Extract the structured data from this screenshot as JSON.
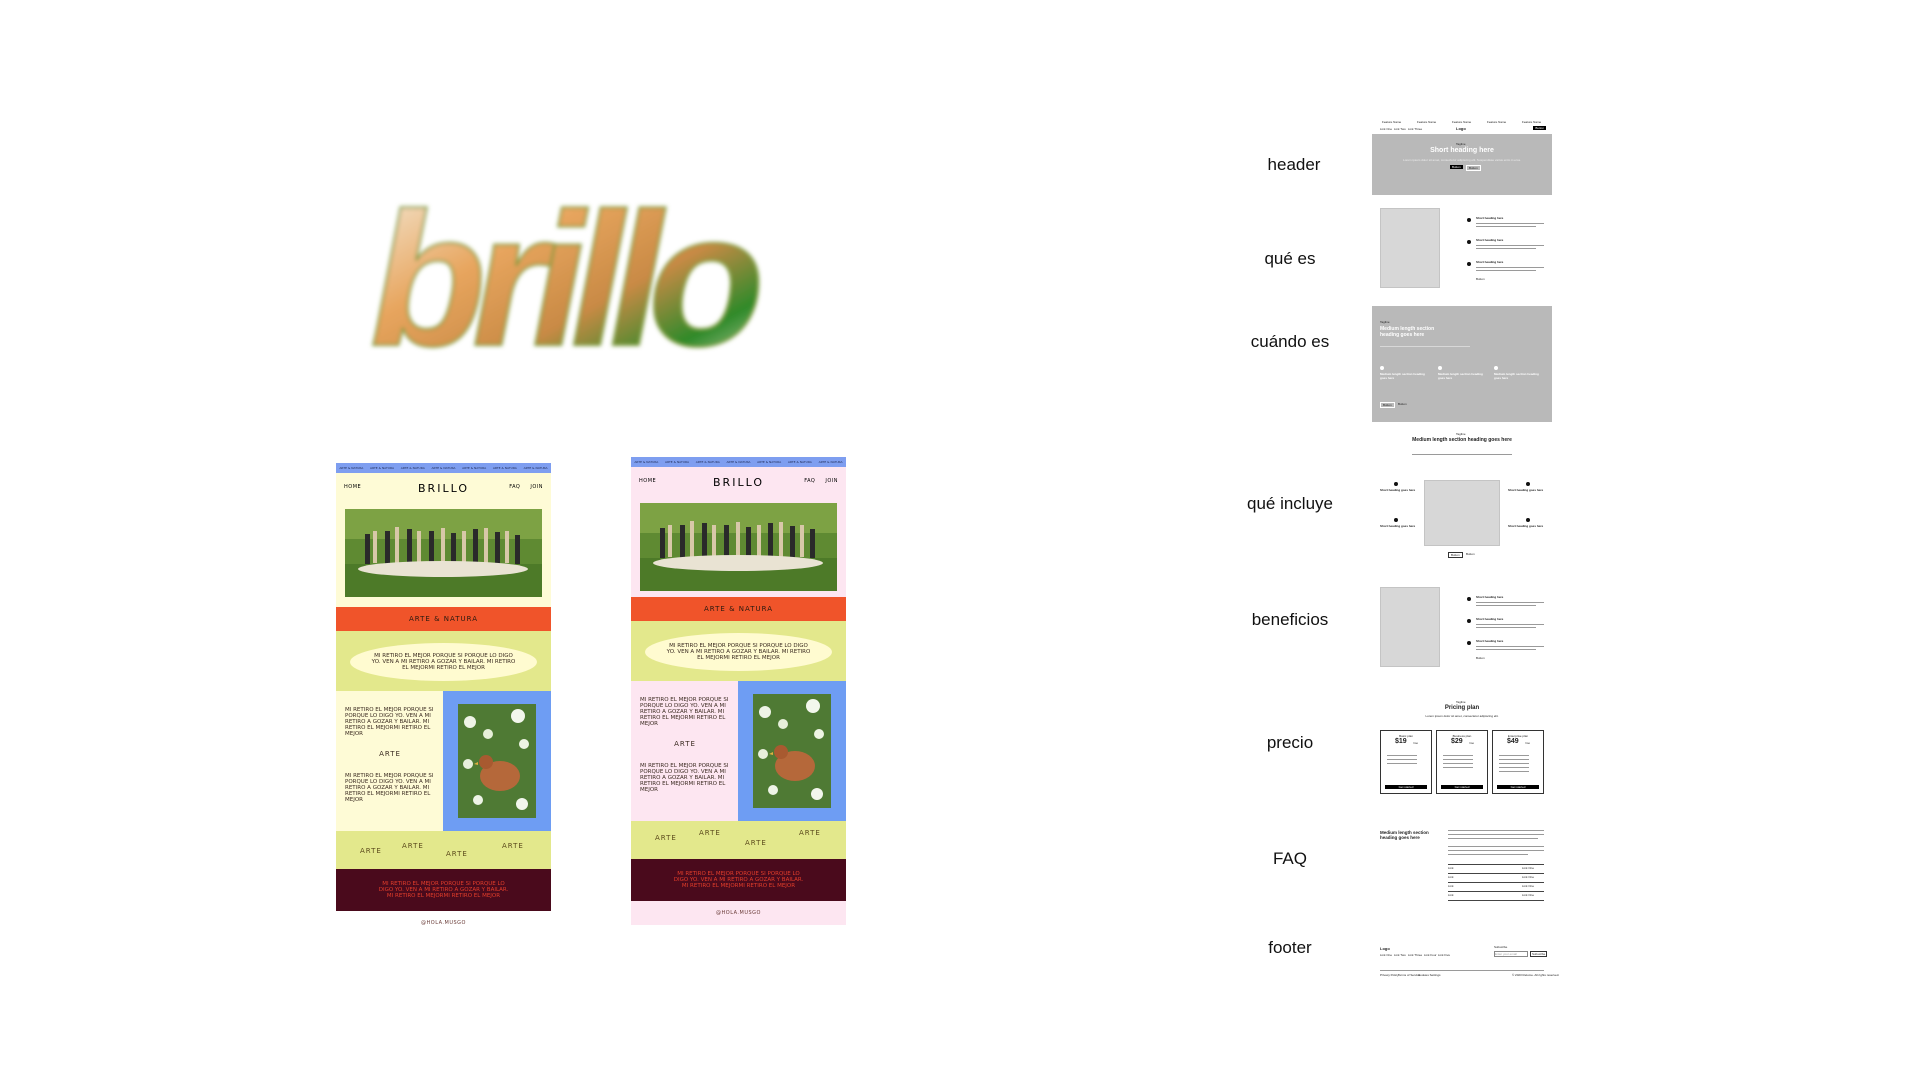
{
  "logo": {
    "text": "brillo"
  },
  "mockups": [
    {
      "id": "yellow",
      "ticker": [
        "ARTE & NATURA",
        "ARTE & NATURA",
        "ARTE & NATURA",
        "ARTE & NATURA",
        "ARTE & NATURA",
        "ARTE & NATURA",
        "ARTE & NATURA"
      ],
      "nav_home": "HOME",
      "brand": "BRILLO",
      "nav_faq": "FAQ",
      "nav_join": "JOIN",
      "band": "ARTE & NATURA",
      "ellipse_text": "MI RETIRO EL MEJOR PORQUE SI PORQUE LO DIGO YO. VEN A MI RETIRO A GOZAR Y BAILAR. MI RETIRO EL MEJORMI RETIRO EL MEJOR",
      "split_text_1": "MI RETIRO EL MEJOR PORQUE SI PORQUE LO DIGO YO. VEN A MI RETIRO A GOZAR Y BAILAR. MI RETIRO EL MEJORMI RETIRO EL MEJOR",
      "split_mid": "ARTE",
      "split_text_2": "MI RETIRO EL MEJOR PORQUE SI PORQUE LO DIGO YO. VEN A MI RETIRO A GOZAR Y BAILAR. MI RETIRO EL MEJORMI RETIRO EL MEJOR",
      "arte": [
        "ARTE",
        "ARTE",
        "ARTE",
        "ARTE"
      ],
      "quote": "MI RETIRO EL MEJOR PORQUE SI PORQUE LO DIGO YO. VEN A MI RETIRO A GOZAR Y BAILAR. MI RETIRO EL MEJORMI RETIRO EL MEJOR",
      "footer": "@HOLA.MUSGO"
    },
    {
      "id": "pink",
      "ticker": [
        "ARTE & NATURA",
        "ARTE & NATURA",
        "ARTE & NATURA",
        "ARTE & NATURA",
        "ARTE & NATURA",
        "ARTE & NATURA",
        "ARTE & NATURA"
      ],
      "nav_home": "HOME",
      "brand": "BRILLO",
      "nav_faq": "FAQ",
      "nav_join": "JOIN",
      "band": "ARTE & NATURA",
      "ellipse_text": "MI RETIRO EL MEJOR PORQUE SI PORQUE LO DIGO YO. VEN A MI RETIRO A GOZAR Y BAILAR. MI RETIRO EL MEJORMI RETIRO EL MEJOR",
      "split_text_1": "MI RETIRO EL MEJOR PORQUE SI PORQUE LO DIGO YO. VEN A MI RETIRO A GOZAR Y BAILAR. MI RETIRO EL MEJORMI RETIRO EL MEJOR",
      "split_mid": "ARTE",
      "split_text_2": "MI RETIRO EL MEJOR PORQUE SI PORQUE LO DIGO YO. VEN A MI RETIRO A GOZAR Y BAILAR. MI RETIRO EL MEJORMI RETIRO EL MEJOR",
      "arte": [
        "ARTE",
        "ARTE",
        "ARTE",
        "ARTE"
      ],
      "quote": "MI RETIRO EL MEJOR PORQUE SI PORQUE LO DIGO YO. VEN A MI RETIRO A GOZAR Y BAILAR. MI RETIRO EL MEJORMI RETIRO EL MEJOR",
      "footer": "@HOLA.MUSGO"
    }
  ],
  "sections": [
    "header",
    "qué es",
    "cuándo es",
    "qué incluye",
    "beneficios",
    "precio",
    "FAQ",
    "footer"
  ],
  "wireframe": {
    "header": {
      "top_links": [
        "Feature Name",
        "Feature Name",
        "Feature Name",
        "Feature Name",
        "Feature Name"
      ],
      "logo": "Logo",
      "nav_links": [
        "Link One",
        "Link Two",
        "Link Three"
      ],
      "button": "Button",
      "tagline": "Tagline",
      "heading": "Short heading here",
      "body": "Lorem ipsum dolor sit amet, consectetur adipiscing elit. Suspendisse varius enim in eros.",
      "btn_primary": "Button",
      "btn_secondary": "Button"
    },
    "que_es": {
      "items": [
        {
          "title": "Short heading here",
          "body": "Lorem ipsum dolor sit amet, consectetur adipiscing elit. Suspendisse varius enim in eros elementum tristique."
        },
        {
          "title": "Short heading here",
          "body": "Lorem ipsum dolor sit amet, consectetur adipiscing elit. Suspendisse varius enim in eros elementum tristique."
        },
        {
          "title": "Short heading here",
          "body": "Lorem ipsum dolor sit amet, consectetur adipiscing elit. Suspendisse varius enim in eros elementum tristique."
        }
      ],
      "link": "Button"
    },
    "cuando_es": {
      "tagline": "Tagline",
      "heading": "Medium length section heading goes here",
      "body": "Lorem ipsum dolor sit amet, consectetur adipiscing elit. Suspendisse varius enim in eros elementum tristique.",
      "cols": [
        "Medium length section heading goes here",
        "Medium length section heading goes here",
        "Medium length section heading goes here"
      ],
      "btn_primary": "Button",
      "btn_secondary": "Button"
    },
    "que_incluye": {
      "tagline": "Tagline",
      "heading": "Medium length section heading goes here",
      "body": "Lorem ipsum dolor sit amet, consectetur adipiscing elit. Suspendisse varius enim in eros elementum tristique.",
      "items": [
        "Short heading goes here",
        "Short heading goes here",
        "Short heading goes here",
        "Short heading goes here"
      ],
      "btn_primary": "Button",
      "btn_secondary": "Button"
    },
    "beneficios": {
      "items": [
        "Short heading here",
        "Short heading here",
        "Short heading here"
      ],
      "link": "Button"
    },
    "precio": {
      "tagline": "Tagline",
      "heading": "Pricing plan",
      "body": "Lorem ipsum dolor sit amet, consectetur adipiscing elit.",
      "plans": [
        {
          "name": "Basic plan",
          "price": "$19",
          "unit": "/mo",
          "cta": "Get started"
        },
        {
          "name": "Business plan",
          "price": "$29",
          "unit": "/mo",
          "cta": "Get started"
        },
        {
          "name": "Enterprise plan",
          "price": "$49",
          "unit": "/mo",
          "cta": "Get started"
        }
      ]
    },
    "faq": {
      "heading": "Medium length section heading goes here",
      "body": "Lorem ipsum dolor sit amet, consectetur adipiscing elit. Suspendisse varius enim in eros elementum tristique.",
      "rows": [
        "Link",
        "Link",
        "Link",
        "Link"
      ],
      "row_right": [
        "Link One",
        "Link One",
        "Link One",
        "Link One"
      ]
    },
    "footer": {
      "logo": "Logo",
      "links": [
        "Link One",
        "Link Two",
        "Link Three",
        "Link Four",
        "Link Five"
      ],
      "subscribe_label": "Subscribe",
      "input_placeholder": "Enter your email",
      "button": "Subscribe",
      "legal": [
        "Privacy Policy",
        "Terms of Service",
        "Cookies Settings"
      ],
      "copyright": "© 2023 Relume. All rights reserved."
    }
  },
  "colors": {
    "ticker_blue": "#7e9ef0",
    "cream": "#fefbd6",
    "pink": "#fde6f1",
    "orange": "#f0542a",
    "lime": "#e3e88c",
    "blue": "#6e9df3",
    "maroon": "#4a0a1c",
    "red_text": "#e43d2b"
  }
}
